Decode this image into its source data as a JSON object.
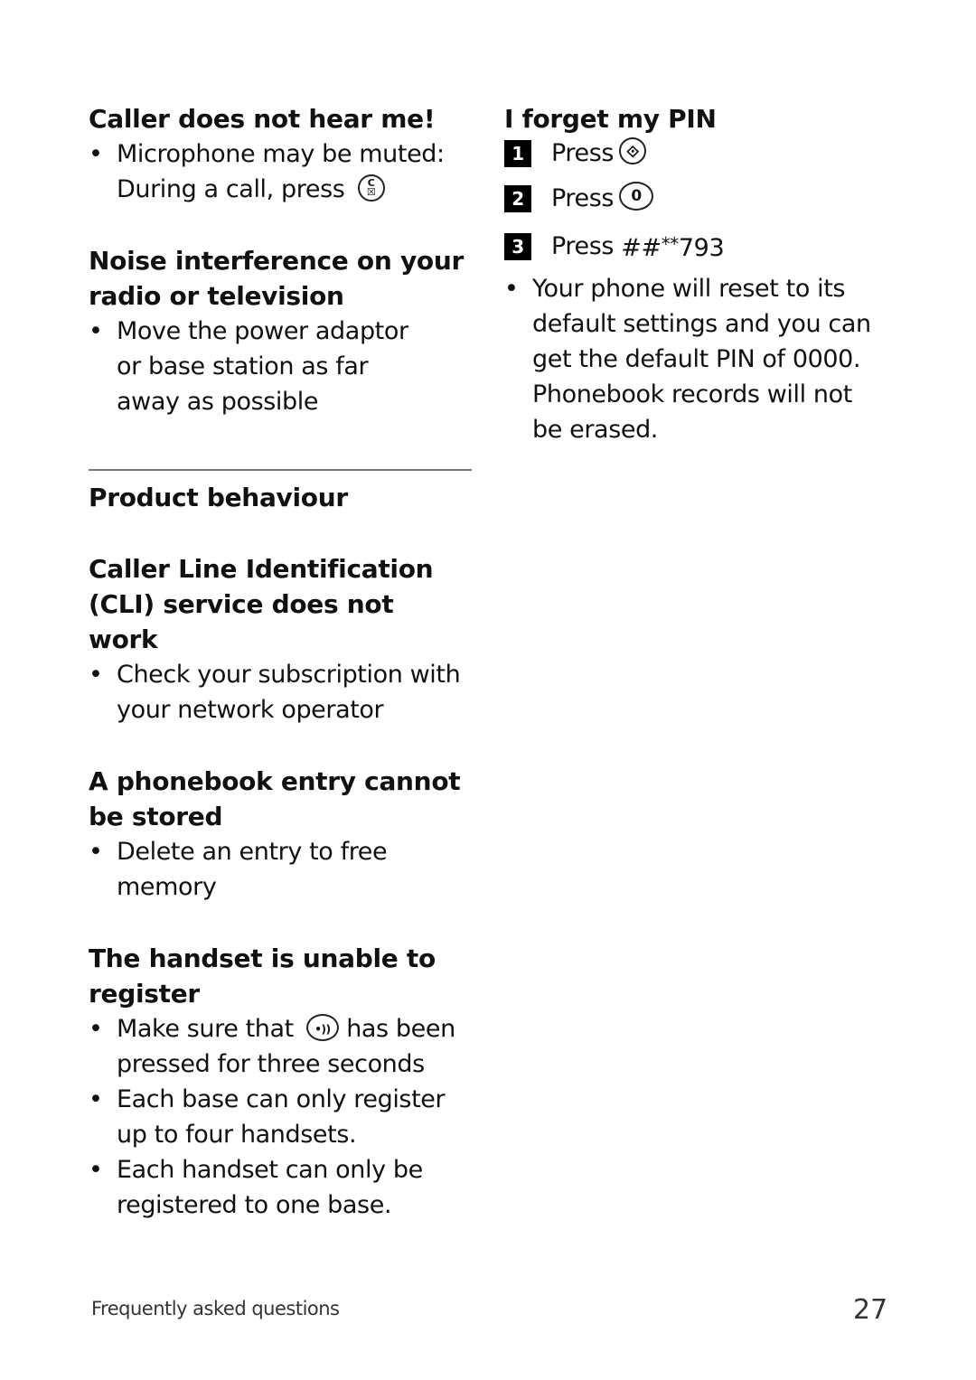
{
  "left_column": {
    "caller_not_hear": {
      "heading": "Caller does not hear me!",
      "item1_line1": "Microphone may be muted:",
      "item1_line2": "During a call, press",
      "icon": "mute-key-icon",
      "icon_glyph_top": "C",
      "icon_glyph_bottom": "☒"
    },
    "noise": {
      "heading": "Noise interference on your radio or television",
      "item1": "Move the power adaptor or base station as far away as possible"
    },
    "product_behaviour": {
      "heading": "Product behaviour"
    },
    "cli": {
      "heading": "Caller Line Identification (CLI) service does not work",
      "item1": "Check your subscription with your network operator"
    },
    "phonebook": {
      "heading": "A phonebook entry cannot be stored",
      "item1": "Delete an entry to free memory"
    },
    "register": {
      "heading": "The handset is unable to register",
      "item1_before": "Make sure that",
      "item1_icon": "paging-key-icon",
      "item1_icon_glyph": "•))",
      "item1_after": "has been pressed for three seconds",
      "item2": "Each base can only register up to four handsets.",
      "item3": "Each handset can only be registered to one base."
    }
  },
  "right_column": {
    "forget_pin": {
      "heading": "I forget my PIN",
      "steps": [
        {
          "num": "1",
          "label": "Press",
          "icon": "menu-ok-key-icon",
          "glyph": "⟐"
        },
        {
          "num": "2",
          "label": "Press",
          "icon": "zero-key-icon",
          "glyph": "0"
        },
        {
          "num": "3",
          "label": "Press",
          "code_prefix": "##",
          "code_stars": "**",
          "code_suffix": "793"
        }
      ],
      "note": "Your phone will reset to its default settings and you can get the default PIN of 0000. Phonebook records will not be erased."
    }
  },
  "bullet": "•",
  "footer": {
    "section": "Frequently asked questions",
    "page_number": "27"
  }
}
